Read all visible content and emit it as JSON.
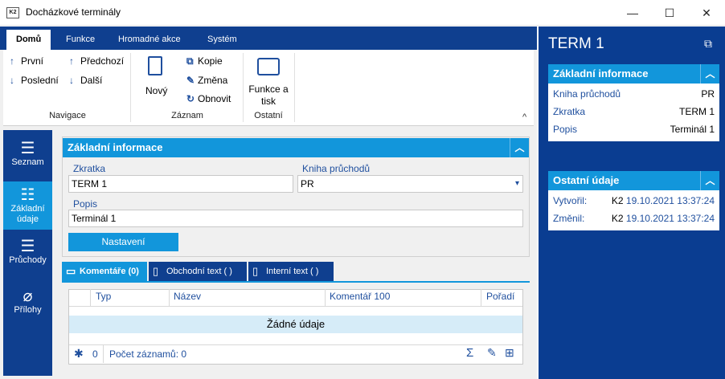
{
  "window": {
    "title": "Docházkové terminály",
    "app_icon": "K2",
    "minimize": "—",
    "maximize": "☐",
    "close": "✕"
  },
  "ribbon": {
    "tabs": [
      "Domů",
      "Funkce",
      "Hromadné akce",
      "Systém"
    ],
    "navigace": {
      "first": "První",
      "prev": "Předchozí",
      "last": "Poslední",
      "next": "Další",
      "label": "Navigace"
    },
    "zaznam": {
      "new": "Nový",
      "copy": "Kopie",
      "change": "Změna",
      "refresh": "Obnovit",
      "label": "Záznam"
    },
    "ostatni": {
      "functions": "Funkce a\ntisk",
      "label": "Ostatní"
    },
    "collapse": "^"
  },
  "leftnav": [
    {
      "label": "Seznam"
    },
    {
      "label": "Základní\núdaje"
    },
    {
      "label": "Průchody"
    },
    {
      "label": "Přílohy"
    }
  ],
  "basic_info": {
    "title": "Základní informace",
    "zkratka_label": "Zkratka",
    "zkratka_value": "TERM 1",
    "kniha_label": "Kniha průchodů",
    "kniha_value": "PR",
    "popis_label": "Popis",
    "popis_value": "Terminál 1",
    "settings_button": "Nastavení"
  },
  "content_tabs": [
    "Komentáře (0)",
    "Obchodní text ( )",
    "Interní text ( )"
  ],
  "grid": {
    "columns": [
      "Typ",
      "Název",
      "Komentář 100",
      "Pořadí"
    ],
    "empty_text": "Žádné údaje",
    "filter_count": "0",
    "record_count": "Počet záznamů: 0"
  },
  "right_panel": {
    "title": "TERM 1",
    "basic": {
      "title": "Základní informace",
      "rows": [
        {
          "key": "Kniha průchodů",
          "value": "PR"
        },
        {
          "key": "Zkratka",
          "value": "TERM 1"
        },
        {
          "key": "Popis",
          "value": "Terminál 1"
        }
      ]
    },
    "other": {
      "title": "Ostatní údaje",
      "created_label": "Vytvořil:",
      "created_user": "K2",
      "created_date": "19.10.2021 13:37:24",
      "changed_label": "Změnil:",
      "changed_user": "K2",
      "changed_date": "19.10.2021 13:37:24"
    }
  },
  "colors": {
    "dark_blue": "#0f3f8f",
    "accent": "#1296db",
    "selected_row": "#d6ecf8"
  }
}
